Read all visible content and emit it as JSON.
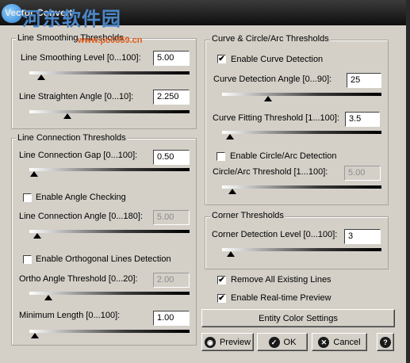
{
  "window": {
    "title": "Vector Convert"
  },
  "watermark": {
    "text": "河东软件园",
    "url": "www.pc0359.cn"
  },
  "line_smoothing": {
    "legend": "Line Smoothing Thresholds",
    "level_label": "Line Smoothing Level [0...100]:",
    "level_value": "5.00",
    "level_slider": 0.05,
    "angle_label": "Line Straighten Angle [0...10]:",
    "angle_value": "2.250",
    "angle_slider": 0.225
  },
  "line_connection": {
    "legend": "Line Connection Thresholds",
    "gap_label": "Line Connection Gap [0...100]:",
    "gap_value": "0.50",
    "gap_slider": 0.005,
    "angle_check_label": "Enable Angle Checking",
    "angle_check_checked": false,
    "angle_label": "Line Connection Angle [0...180]:",
    "angle_value": "5.00",
    "angle_slider": 0.028,
    "ortho_check_label": "Enable Orthogonal Lines Detection",
    "ortho_check_checked": false,
    "ortho_label": "Ortho Angle Threshold [0...20]:",
    "ortho_value": "2.00",
    "ortho_slider": 0.1,
    "minlen_label": "Minimum Length [0...100]:",
    "minlen_value": "1.00",
    "minlen_slider": 0.01
  },
  "curve": {
    "legend": "Curve & Circle/Arc Thresholds",
    "detect_label": "Enable Curve Detection",
    "detect_checked": true,
    "angle_label": "Curve Detection Angle [0...90]:",
    "angle_value": "25",
    "angle_slider": 0.28,
    "fitting_label": "Curve Fitting Threshold [1...100]:",
    "fitting_value": "3.5",
    "fitting_slider": 0.025,
    "circle_label": "Enable Circle/Arc Detection",
    "circle_checked": false,
    "circle_threshold_label": "Circle/Arc Threshold [1...100]:",
    "circle_threshold_value": "5.00",
    "circle_threshold_slider": 0.04
  },
  "corner": {
    "legend": "Corner Thresholds",
    "level_label": "Corner Detection Level [0...100]:",
    "level_value": "3",
    "level_slider": 0.03
  },
  "options": {
    "remove_label": "Remove All Existing Lines",
    "remove_checked": true,
    "realtime_label": "Enable Real-time Preview",
    "realtime_checked": true
  },
  "buttons": {
    "entity_color": "Entity Color Settings",
    "preview": "Preview",
    "ok": "OK",
    "cancel": "Cancel",
    "help": "?"
  },
  "check_glyph": "✔"
}
